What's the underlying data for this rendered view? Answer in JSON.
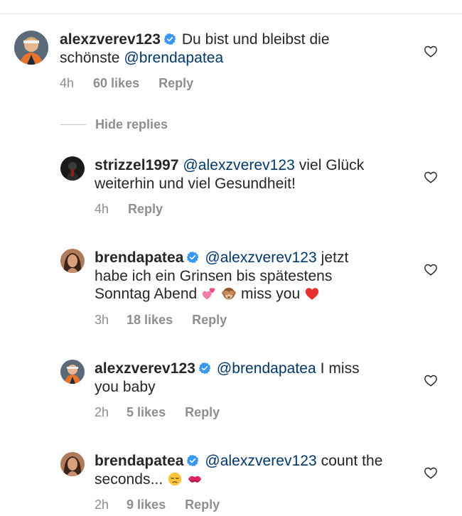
{
  "comments": [
    {
      "username": "alexzverev123",
      "verified": true,
      "lines": [
        {
          "pre": "Du bist und bleibst die",
          "mention": "",
          "post": ""
        },
        {
          "pre": "schönste ",
          "mention": "@brendapatea",
          "post": ""
        }
      ],
      "time": "4h",
      "likes": "60 likes",
      "reply_label": "Reply"
    }
  ],
  "hide_replies_label": "Hide replies",
  "replies": [
    {
      "username": "strizzel1997",
      "verified": false,
      "line1_mention": "@alexzverev123",
      "line1_post": " viel Glück",
      "line2": "weiterhin und viel Gesundheit!",
      "time": "4h",
      "likes": "",
      "reply_label": "Reply"
    },
    {
      "username": "brendapatea",
      "verified": true,
      "line1_mention": "@alexzverev123",
      "line1_post": " jetzt",
      "line2": "habe ich ein Grinsen bis spätestens",
      "line3_pre": "Sonntag Abend ",
      "line3_post": " miss you ",
      "emojis": [
        "two-hearts-emoji",
        "see-no-evil-monkey-emoji",
        "red-heart-emoji"
      ],
      "time": "3h",
      "likes": "18 likes",
      "reply_label": "Reply"
    },
    {
      "username": "alexzverev123",
      "verified": true,
      "line1_mention": "@brendapatea",
      "line1_post": " I miss",
      "line2": "you baby",
      "time": "2h",
      "likes": "5 likes",
      "reply_label": "Reply"
    },
    {
      "username": "brendapatea",
      "verified": true,
      "line1_mention": "@alexzverev123",
      "line1_post": " count the",
      "line2_pre": "seconds... ",
      "emojis": [
        "pensive-face-emoji",
        "kiss-mark-emoji"
      ],
      "time": "2h",
      "likes": "9 likes",
      "reply_label": "Reply"
    }
  ],
  "colors": {
    "text": "#262626",
    "mention": "#00376b",
    "meta": "#8e8e8e",
    "verified": "#3897f0",
    "divider": "#e6e6e6"
  },
  "icons": {
    "like": "heart-outline-icon",
    "verified": "verified-badge-icon"
  }
}
